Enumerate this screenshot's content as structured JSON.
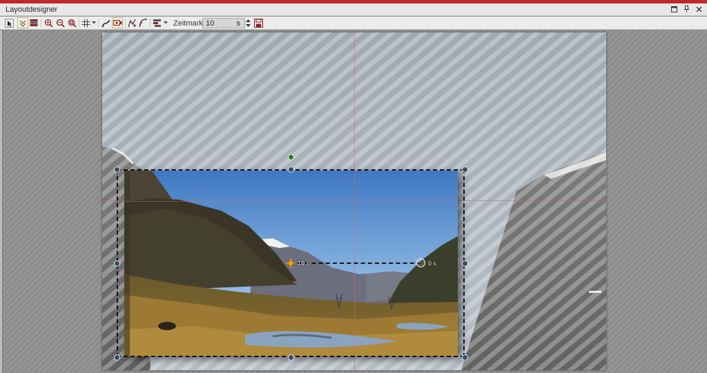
{
  "window": {
    "title": "Layoutdesigner",
    "accent_color": "#c0282b",
    "controls": [
      "restore-icon",
      "pin-icon",
      "close-icon"
    ]
  },
  "toolbar": {
    "tools": [
      "selection-tool-icon",
      "hide-others-icon",
      "layers-icon",
      "zoom-in-icon",
      "zoom-out-icon",
      "zoom-fit-icon",
      "grid-icon",
      "motion-path-icon",
      "camera-icon",
      "keyframe-add-icon",
      "keyframe-remove-icon",
      "align-icon"
    ],
    "zeitmarke_label": "Zeitmarke:",
    "zeitmarke_value": "10",
    "zeitmarke_unit": "s"
  },
  "canvas": {
    "keyframe_start_label": "10 s",
    "keyframe_end_label": "0 s",
    "selection_color": "#111111",
    "handle_color": "#3a4a68",
    "rotation_handle_color": "#2e7d32",
    "guide_color": "#d06060"
  }
}
